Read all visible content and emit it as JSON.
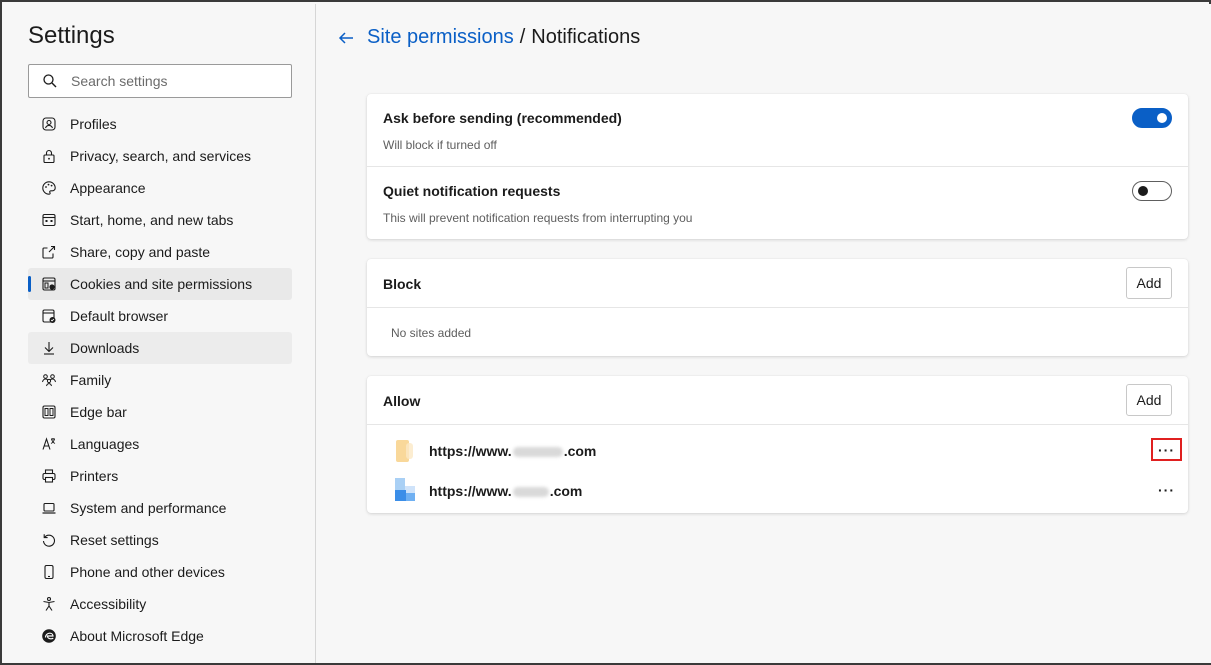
{
  "sidebar": {
    "title": "Settings",
    "search_placeholder": "Search settings",
    "items": [
      {
        "label": "Profiles",
        "icon": "profile-icon"
      },
      {
        "label": "Privacy, search, and services",
        "icon": "lock-icon"
      },
      {
        "label": "Appearance",
        "icon": "palette-icon"
      },
      {
        "label": "Start, home, and new tabs",
        "icon": "home-tab-icon"
      },
      {
        "label": "Share, copy and paste",
        "icon": "share-icon"
      },
      {
        "label": "Cookies and site permissions",
        "icon": "cookies-icon",
        "active": true
      },
      {
        "label": "Default browser",
        "icon": "browser-icon"
      },
      {
        "label": "Downloads",
        "icon": "download-icon",
        "hover": true
      },
      {
        "label": "Family",
        "icon": "family-icon"
      },
      {
        "label": "Edge bar",
        "icon": "edge-bar-icon"
      },
      {
        "label": "Languages",
        "icon": "language-icon"
      },
      {
        "label": "Printers",
        "icon": "printer-icon"
      },
      {
        "label": "System and performance",
        "icon": "laptop-icon"
      },
      {
        "label": "Reset settings",
        "icon": "reset-icon"
      },
      {
        "label": "Phone and other devices",
        "icon": "phone-icon"
      },
      {
        "label": "Accessibility",
        "icon": "accessibility-icon"
      },
      {
        "label": "About Microsoft Edge",
        "icon": "edge-logo-icon"
      }
    ]
  },
  "header": {
    "breadcrumb_parent": "Site permissions",
    "separator": "/",
    "current": "Notifications"
  },
  "settings": {
    "ask_title": "Ask before sending (recommended)",
    "ask_sub": "Will block if turned off",
    "ask_enabled": true,
    "quiet_title": "Quiet notification requests",
    "quiet_sub": "This will prevent notification requests from interrupting you",
    "quiet_enabled": false
  },
  "block": {
    "title": "Block",
    "add_label": "Add",
    "empty_text": "No sites added"
  },
  "allow": {
    "title": "Allow",
    "add_label": "Add",
    "sites": [
      {
        "url_prefix": "https://www.",
        "url_suffix": ".com",
        "more_label": "···"
      },
      {
        "url_prefix": "https://www.",
        "url_suffix": ".com",
        "more_label": "···"
      }
    ]
  },
  "colors": {
    "accent": "#0a5fc6",
    "highlight": "#e02020"
  }
}
